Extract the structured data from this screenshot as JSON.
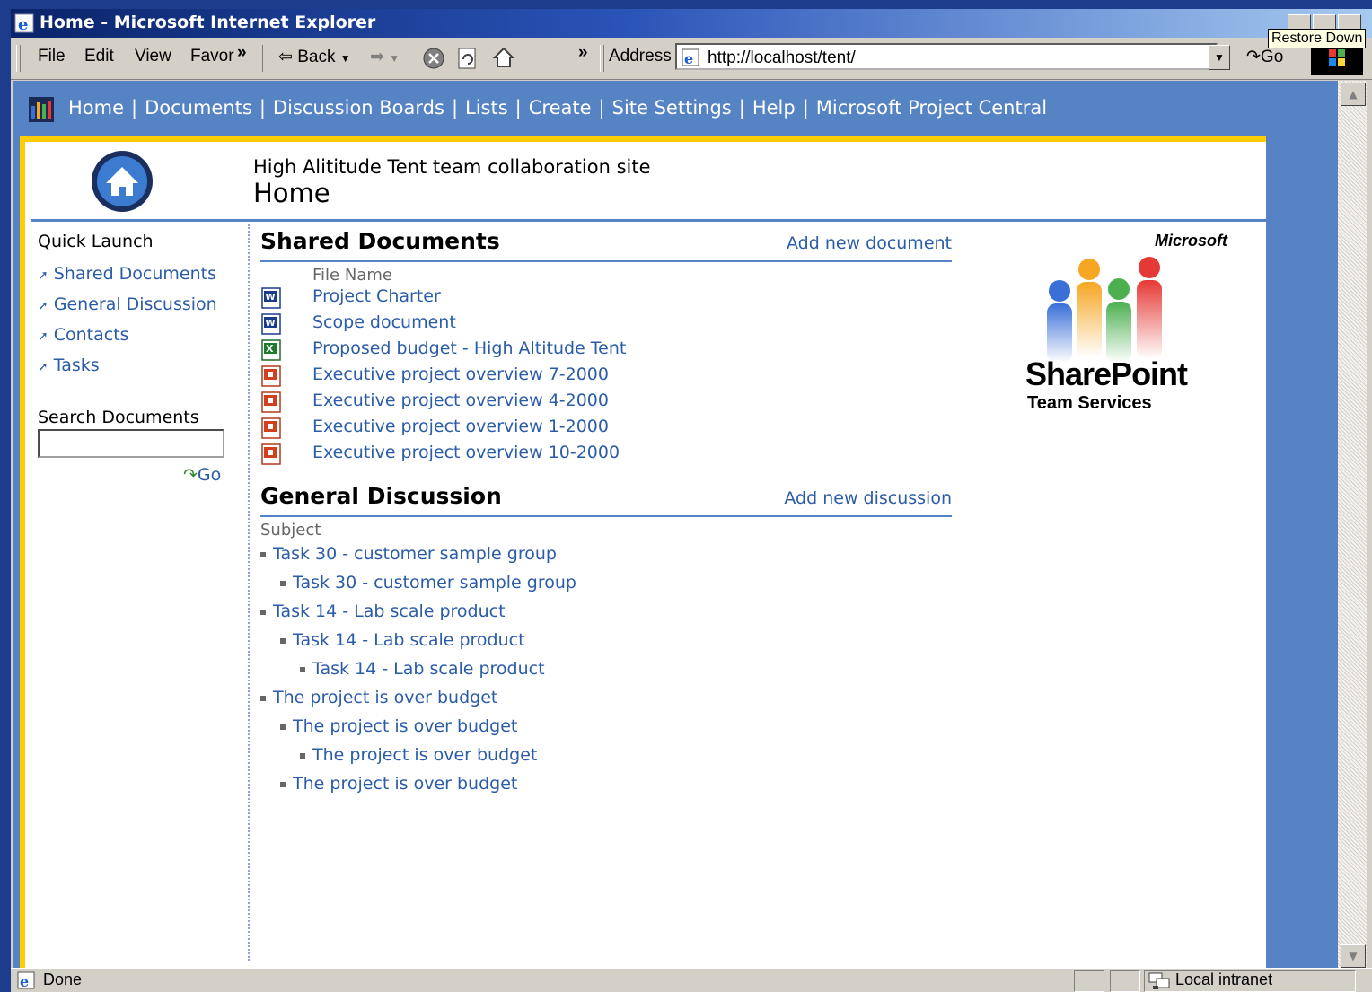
{
  "window": {
    "title": "Home - Microsoft Internet Explorer",
    "tooltip": "Restore Down"
  },
  "toolbar": {
    "menu": [
      "File",
      "Edit",
      "View",
      "Favor"
    ],
    "chevron": "»",
    "back_label": "Back",
    "address_label": "Address",
    "address_url": "http://localhost/tent/",
    "go_label": "Go"
  },
  "topnav": {
    "links": [
      "Home",
      "Documents",
      "Discussion Boards",
      "Lists",
      "Create",
      "Site Settings",
      "Help",
      "Microsoft Project Central"
    ]
  },
  "site": {
    "subtitle": "High Alititude Tent team collaboration site",
    "title": "Home"
  },
  "quick_launch": {
    "heading": "Quick Launch",
    "items": [
      "Shared Documents",
      "General Discussion",
      "Contacts",
      "Tasks"
    ]
  },
  "search": {
    "heading": "Search Documents",
    "go_label": "Go"
  },
  "shared_documents": {
    "heading": "Shared Documents",
    "add_label": "Add new document",
    "column": "File Name",
    "files": [
      {
        "name": "Project Charter",
        "icon": "word-doc-icon"
      },
      {
        "name": "Scope document",
        "icon": "word-doc-icon"
      },
      {
        "name": "Proposed budget - High Altitude Tent",
        "icon": "excel-doc-icon"
      },
      {
        "name": "Executive project overview 7-2000",
        "icon": "powerpoint-doc-icon"
      },
      {
        "name": "Executive project overview 4-2000",
        "icon": "powerpoint-doc-icon"
      },
      {
        "name": "Executive project overview 1-2000",
        "icon": "powerpoint-doc-icon"
      },
      {
        "name": "Executive project overview 10-2000",
        "icon": "powerpoint-doc-icon"
      }
    ]
  },
  "general_discussion": {
    "heading": "General Discussion",
    "add_label": "Add new discussion",
    "column": "Subject",
    "threads": [
      {
        "subject": "Task 30 - customer sample group",
        "level": 0
      },
      {
        "subject": "Task 30 - customer sample group",
        "level": 1
      },
      {
        "subject": "Task 14 - Lab scale product",
        "level": 0
      },
      {
        "subject": "Task 14 - Lab scale product",
        "level": 1
      },
      {
        "subject": "Task 14 - Lab scale product",
        "level": 2
      },
      {
        "subject": "The project is over budget",
        "level": 0
      },
      {
        "subject": "The project is over budget",
        "level": 1
      },
      {
        "subject": "The project is over budget",
        "level": 2
      },
      {
        "subject": "The project is over budget",
        "level": 1
      }
    ]
  },
  "sharepoint_logo": {
    "brand": "Microsoft",
    "product": "SharePoint",
    "subtitle": "Team Services",
    "colors": [
      "#3a6fd8",
      "#f5a623",
      "#4caf50",
      "#e53935"
    ]
  },
  "status": {
    "text": "Done",
    "zone": "Local intranet"
  }
}
